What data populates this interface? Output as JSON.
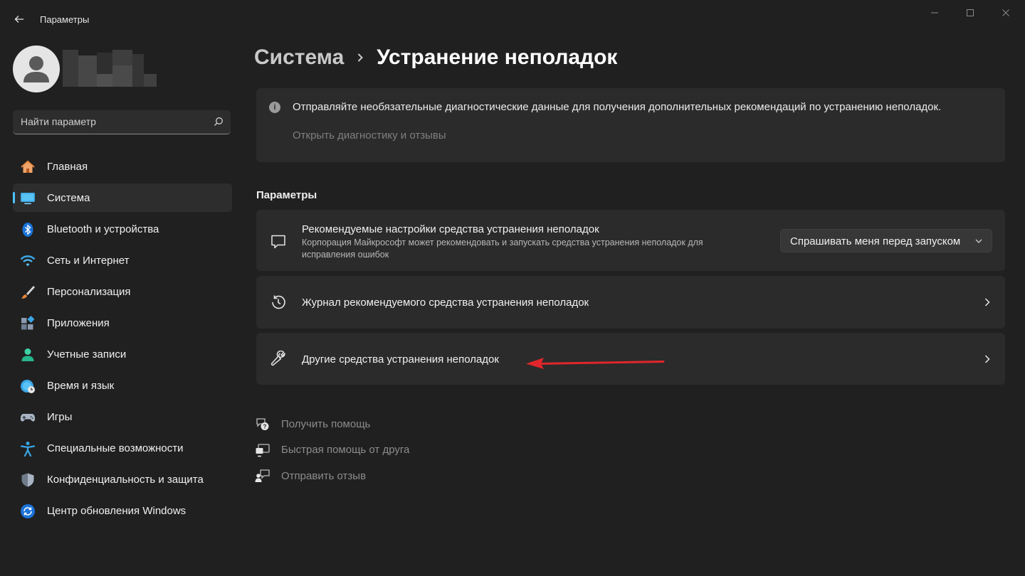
{
  "app": {
    "title": "Параметры"
  },
  "user": {
    "name_redacted": true
  },
  "search": {
    "placeholder": "Найти параметр"
  },
  "sidebar": {
    "items": [
      {
        "label": "Главная",
        "icon": "home-icon",
        "active": false
      },
      {
        "label": "Система",
        "icon": "system-icon",
        "active": true
      },
      {
        "label": "Bluetooth и устройства",
        "icon": "bluetooth-icon",
        "active": false
      },
      {
        "label": "Сеть и Интернет",
        "icon": "wifi-icon",
        "active": false
      },
      {
        "label": "Персонализация",
        "icon": "brush-icon",
        "active": false
      },
      {
        "label": "Приложения",
        "icon": "apps-icon",
        "active": false
      },
      {
        "label": "Учетные записи",
        "icon": "account-icon",
        "active": false
      },
      {
        "label": "Время и язык",
        "icon": "globe-clock-icon",
        "active": false
      },
      {
        "label": "Игры",
        "icon": "gamepad-icon",
        "active": false
      },
      {
        "label": "Специальные возможности",
        "icon": "accessibility-icon",
        "active": false
      },
      {
        "label": "Конфиденциальность и защита",
        "icon": "shield-icon",
        "active": false
      },
      {
        "label": "Центр обновления Windows",
        "icon": "update-icon",
        "active": false
      }
    ]
  },
  "breadcrumb": {
    "parent": "Система",
    "current": "Устранение неполадок"
  },
  "info": {
    "text": "Отправляйте необязательные диагностические данные для получения дополнительных рекомендаций по устранению неполадок.",
    "link": "Открыть диагностику и отзывы"
  },
  "section": {
    "title": "Параметры"
  },
  "cards": {
    "recommended": {
      "title": "Рекомендуемые настройки средства устранения неполадок",
      "description": "Корпорация Майкрософт может рекомендовать и запускать средства устранения неполадок для исправления ошибок",
      "dropdown_value": "Спрашивать меня перед запуском"
    },
    "history": {
      "title": "Журнал рекомендуемого средства устранения неполадок"
    },
    "other": {
      "title": "Другие средства устранения неполадок"
    }
  },
  "help_links": [
    {
      "label": "Получить помощь",
      "icon": "get-help-icon"
    },
    {
      "label": "Быстрая помощь от друга",
      "icon": "quick-assist-icon"
    },
    {
      "label": "Отправить отзыв",
      "icon": "feedback-icon"
    }
  ],
  "colors": {
    "background": "#202020",
    "card": "#2b2b2b",
    "accent": "#4cc2ff",
    "annotation_arrow": "#e0262b"
  }
}
